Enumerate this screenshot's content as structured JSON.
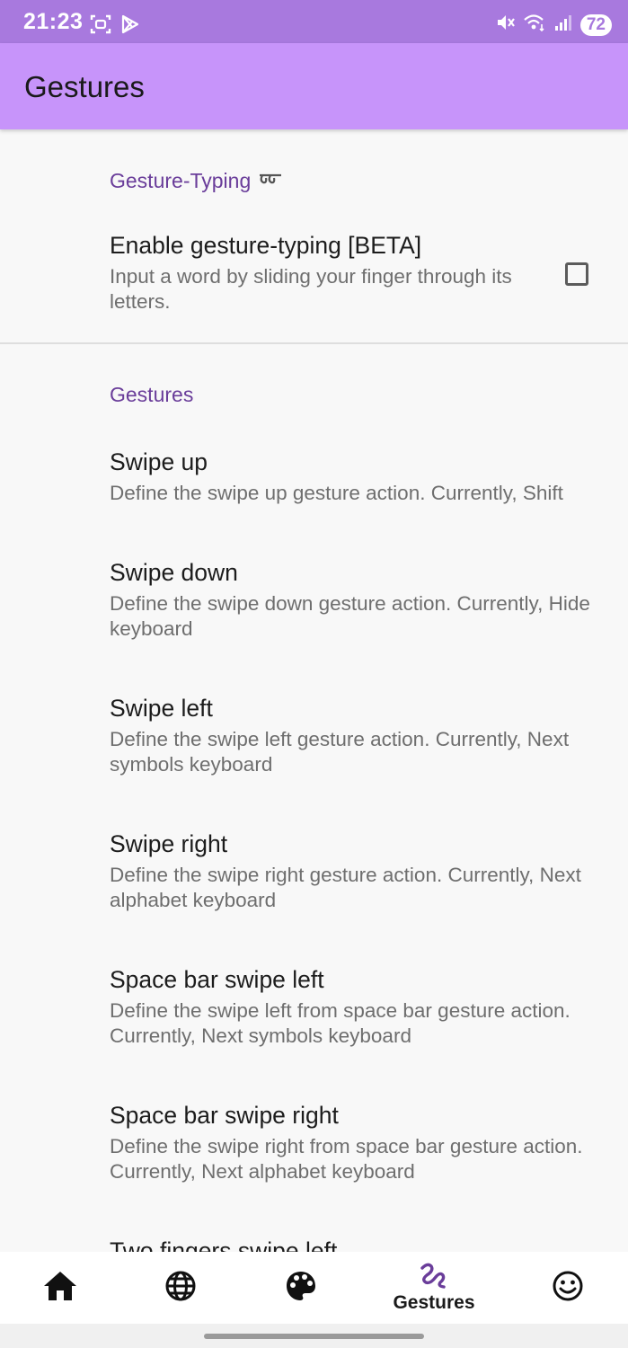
{
  "status_bar": {
    "time": "21:23",
    "battery": "72",
    "icons": [
      "screenshot-icon",
      "play-store-icon",
      "mute-icon",
      "wifi-icon",
      "signal-icon"
    ]
  },
  "app_bar": {
    "title": "Gestures"
  },
  "sections": {
    "gesture_typing": {
      "header": "Gesture-Typing",
      "header_icon": "gesture-typing-icon",
      "enable": {
        "title": "Enable gesture-typing [BETA]",
        "summary": "Input a word by sliding your finger through its letters.",
        "checked": false
      }
    },
    "gestures": {
      "header": "Gestures",
      "items": [
        {
          "title": "Swipe up",
          "summary": "Define the swipe up gesture action. Currently, Shift"
        },
        {
          "title": "Swipe down",
          "summary": "Define the swipe down gesture action. Currently, Hide keyboard"
        },
        {
          "title": "Swipe left",
          "summary": "Define the swipe left gesture action. Currently, Next symbols keyboard"
        },
        {
          "title": "Swipe right",
          "summary": "Define the swipe right gesture action. Currently, Next alphabet keyboard"
        },
        {
          "title": "Space bar swipe left",
          "summary": "Define the swipe left from space bar gesture action. Currently, Next symbols keyboard"
        },
        {
          "title": "Space bar swipe right",
          "summary": "Define the swipe right from space bar gesture action. Currently, Next alphabet keyboard"
        },
        {
          "title": "Two fingers swipe left",
          "summary": ""
        }
      ]
    }
  },
  "bottom_nav": {
    "items": [
      {
        "icon": "home-icon",
        "label": ""
      },
      {
        "icon": "globe-icon",
        "label": ""
      },
      {
        "icon": "palette-icon",
        "label": ""
      },
      {
        "icon": "gestures-icon",
        "label": "Gestures",
        "selected": true
      },
      {
        "icon": "emoji-icon",
        "label": ""
      }
    ]
  },
  "colors": {
    "status_bar": "#a879de",
    "app_bar": "#c794fa",
    "accent": "#6a3d9a",
    "background": "#f8f8f8"
  }
}
